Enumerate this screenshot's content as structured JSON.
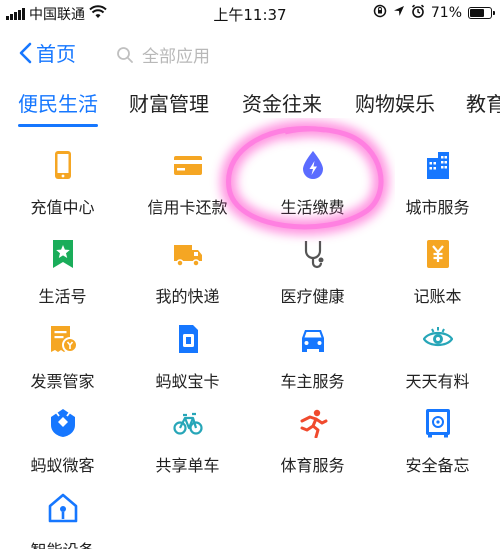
{
  "status_bar": {
    "carrier": "中国联通",
    "time": "上午11:37",
    "battery_percent": "71%",
    "battery_level": 0.71,
    "icons": [
      "signal-bars-icon",
      "wifi-icon",
      "orientation-lock-icon",
      "location-arrow-icon",
      "alarm-icon",
      "battery-icon"
    ]
  },
  "nav": {
    "back_label": "首页",
    "search_placeholder": "全部应用"
  },
  "tabs": [
    {
      "label": "便民生活",
      "active": true
    },
    {
      "label": "财富管理",
      "active": false
    },
    {
      "label": "资金往来",
      "active": false
    },
    {
      "label": "购物娱乐",
      "active": false
    },
    {
      "label": "教育",
      "active": false
    }
  ],
  "services": [
    {
      "label": "充值中心",
      "icon": "phone-icon"
    },
    {
      "label": "信用卡还款",
      "icon": "credit-card-icon"
    },
    {
      "label": "生活缴费",
      "icon": "water-drop-lightning-icon"
    },
    {
      "label": "城市服务",
      "icon": "city-buildings-icon"
    },
    {
      "label": "生活号",
      "icon": "bookmark-star-icon"
    },
    {
      "label": "我的快递",
      "icon": "delivery-truck-icon"
    },
    {
      "label": "医疗健康",
      "icon": "stethoscope-icon"
    },
    {
      "label": "记账本",
      "icon": "ledger-yuan-icon"
    },
    {
      "label": "发票管家",
      "icon": "invoice-icon"
    },
    {
      "label": "蚂蚁宝卡",
      "icon": "sim-card-icon"
    },
    {
      "label": "车主服务",
      "icon": "car-icon"
    },
    {
      "label": "天天有料",
      "icon": "eye-icon"
    },
    {
      "label": "蚂蚁微客",
      "icon": "ant-shield-icon"
    },
    {
      "label": "共享单车",
      "icon": "bicycle-icon"
    },
    {
      "label": "体育服务",
      "icon": "sport-runner-icon"
    },
    {
      "label": "安全备忘",
      "icon": "safe-box-icon"
    },
    {
      "label": "智能设备",
      "icon": "smart-home-icon"
    }
  ],
  "colors": {
    "accent": "#1677ff",
    "orange": "#f5a623",
    "green": "#1aad5a",
    "red": "#f04a2e",
    "teal": "#27a6b8",
    "purple_blue": "#5b6cff",
    "highlight_pink": "#ff3cc8"
  }
}
